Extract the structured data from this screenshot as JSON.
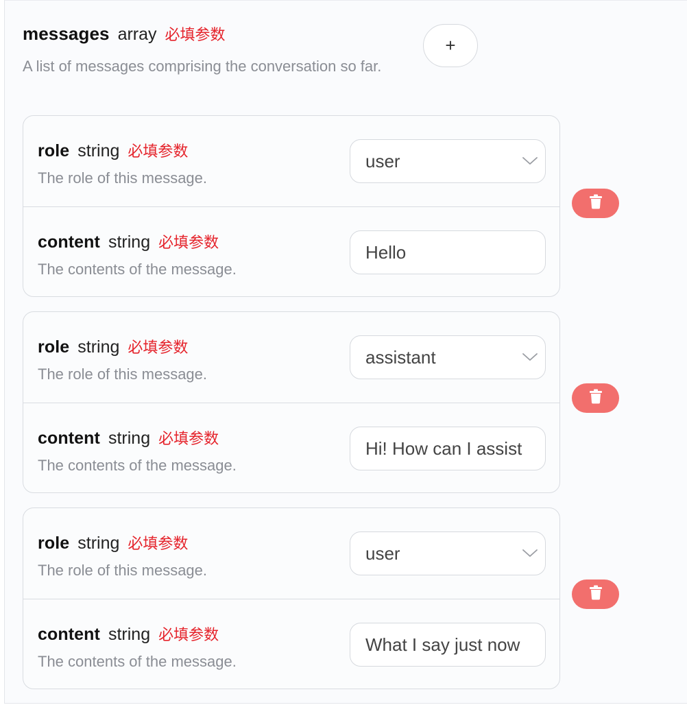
{
  "messages": {
    "name": "messages",
    "type": "array",
    "required_label": "必填参数",
    "description": "A list of messages comprising the conversation so far.",
    "add_label": "+"
  },
  "items": [
    {
      "role": {
        "name": "role",
        "type": "string",
        "required_label": "必填参数",
        "description": "The role of this message.",
        "value": "user"
      },
      "content": {
        "name": "content",
        "type": "string",
        "required_label": "必填参数",
        "description": "The contents of the message.",
        "value": "Hello"
      }
    },
    {
      "role": {
        "name": "role",
        "type": "string",
        "required_label": "必填参数",
        "description": "The role of this message.",
        "value": "assistant"
      },
      "content": {
        "name": "content",
        "type": "string",
        "required_label": "必填参数",
        "description": "The contents of the message.",
        "value": "Hi! How can I assist"
      }
    },
    {
      "role": {
        "name": "role",
        "type": "string",
        "required_label": "必填参数",
        "description": "The role of this message.",
        "value": "user"
      },
      "content": {
        "name": "content",
        "type": "string",
        "required_label": "必填参数",
        "description": "The contents of the message.",
        "value": "What I say just now"
      }
    }
  ],
  "icons": {
    "add": "plus-icon",
    "delete": "trash-icon",
    "select": "chevron-down-icon"
  },
  "colors": {
    "required": "#e5232b",
    "delete_button": "#f26f6d",
    "border": "#d9dce1"
  }
}
